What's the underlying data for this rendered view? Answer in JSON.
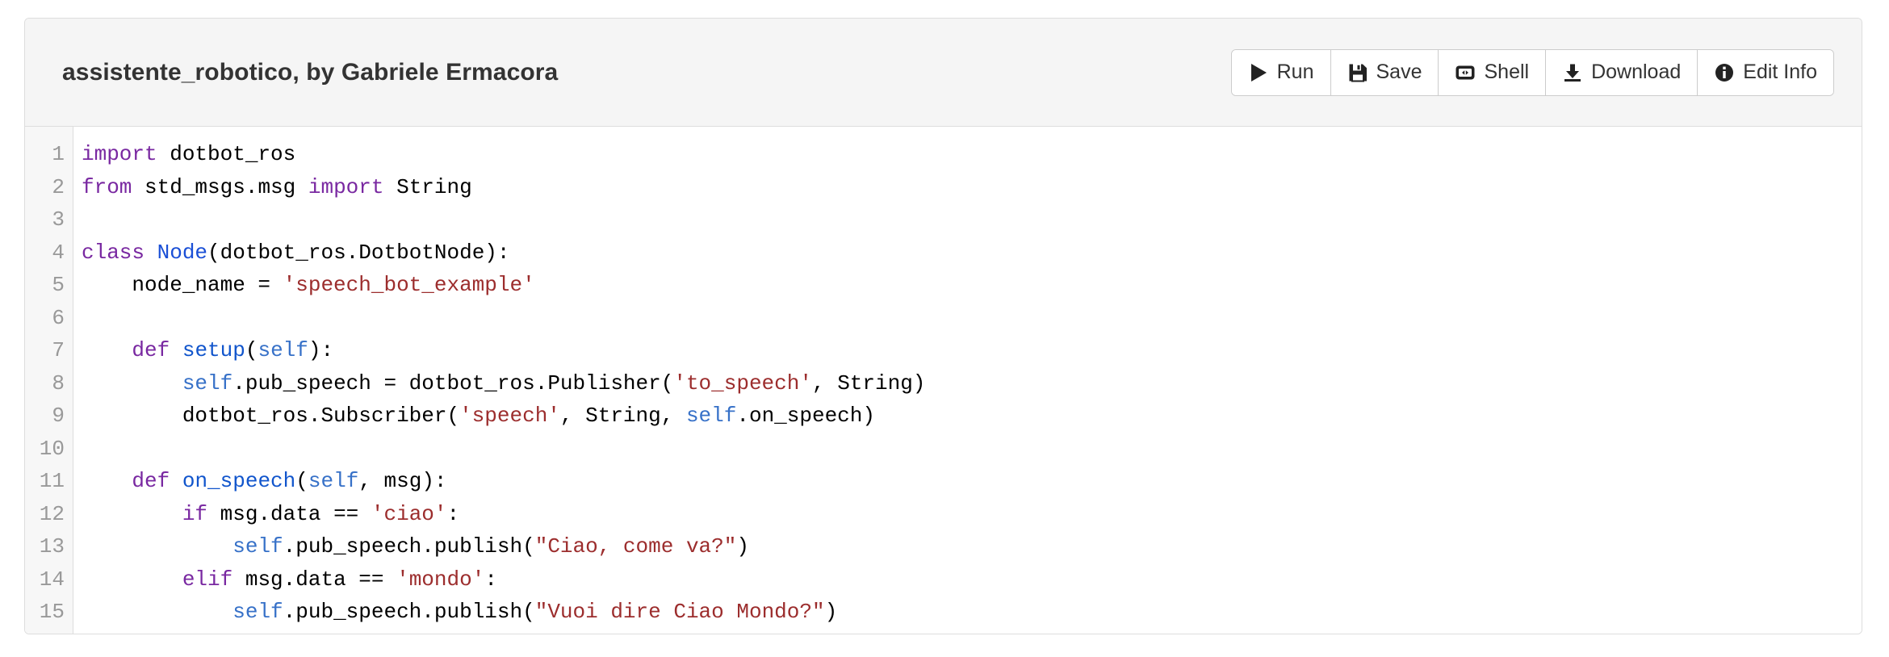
{
  "header": {
    "title": "assistente_robotico, by Gabriele Ermacora",
    "toolbar": [
      {
        "label": "Run",
        "icon": "play-icon"
      },
      {
        "label": "Save",
        "icon": "floppy-disk-icon"
      },
      {
        "label": "Shell",
        "icon": "shell-icon"
      },
      {
        "label": "Download",
        "icon": "download-icon"
      },
      {
        "label": "Edit Info",
        "icon": "info-circle-icon"
      }
    ]
  },
  "editor": {
    "language": "python",
    "first_visible_line": 1,
    "last_visible_line": 15,
    "line_numbers": [
      "1",
      "2",
      "3",
      "4",
      "5",
      "6",
      "7",
      "8",
      "9",
      "10",
      "11",
      "12",
      "13",
      "14",
      "15"
    ],
    "lines": [
      {
        "n": "1",
        "tokens": [
          {
            "t": "import",
            "c": "kw"
          },
          {
            "t": " dotbot_ros",
            "c": "pl"
          }
        ]
      },
      {
        "n": "2",
        "tokens": [
          {
            "t": "from",
            "c": "kw"
          },
          {
            "t": " std_msgs.msg ",
            "c": "pl"
          },
          {
            "t": "import",
            "c": "kw"
          },
          {
            "t": " String",
            "c": "pl"
          }
        ]
      },
      {
        "n": "3",
        "tokens": [
          {
            "t": "",
            "c": "pl"
          }
        ]
      },
      {
        "n": "4",
        "tokens": [
          {
            "t": "class",
            "c": "kw"
          },
          {
            "t": " ",
            "c": "pl"
          },
          {
            "t": "Node",
            "c": "cls"
          },
          {
            "t": "(dotbot_ros.DotbotNode):",
            "c": "pl"
          }
        ]
      },
      {
        "n": "5",
        "tokens": [
          {
            "t": "    node_name = ",
            "c": "pl"
          },
          {
            "t": "'speech_bot_example'",
            "c": "str"
          }
        ]
      },
      {
        "n": "6",
        "tokens": [
          {
            "t": "",
            "c": "pl"
          }
        ]
      },
      {
        "n": "7",
        "tokens": [
          {
            "t": "    ",
            "c": "pl"
          },
          {
            "t": "def",
            "c": "kw"
          },
          {
            "t": " ",
            "c": "pl"
          },
          {
            "t": "setup",
            "c": "fn"
          },
          {
            "t": "(",
            "c": "pl"
          },
          {
            "t": "self",
            "c": "self"
          },
          {
            "t": "):",
            "c": "pl"
          }
        ]
      },
      {
        "n": "8",
        "tokens": [
          {
            "t": "        ",
            "c": "pl"
          },
          {
            "t": "self",
            "c": "self"
          },
          {
            "t": ".pub_speech = dotbot_ros.Publisher(",
            "c": "pl"
          },
          {
            "t": "'to_speech'",
            "c": "str"
          },
          {
            "t": ", String)",
            "c": "pl"
          }
        ]
      },
      {
        "n": "9",
        "tokens": [
          {
            "t": "        dotbot_ros.Subscriber(",
            "c": "pl"
          },
          {
            "t": "'speech'",
            "c": "str"
          },
          {
            "t": ", String, ",
            "c": "pl"
          },
          {
            "t": "self",
            "c": "self"
          },
          {
            "t": ".on_speech)",
            "c": "pl"
          }
        ]
      },
      {
        "n": "10",
        "tokens": [
          {
            "t": "",
            "c": "pl"
          }
        ]
      },
      {
        "n": "11",
        "tokens": [
          {
            "t": "    ",
            "c": "pl"
          },
          {
            "t": "def",
            "c": "kw"
          },
          {
            "t": " ",
            "c": "pl"
          },
          {
            "t": "on_speech",
            "c": "fn"
          },
          {
            "t": "(",
            "c": "pl"
          },
          {
            "t": "self",
            "c": "self"
          },
          {
            "t": ", msg):",
            "c": "pl"
          }
        ]
      },
      {
        "n": "12",
        "tokens": [
          {
            "t": "        ",
            "c": "pl"
          },
          {
            "t": "if",
            "c": "kw"
          },
          {
            "t": " msg.data == ",
            "c": "pl"
          },
          {
            "t": "'ciao'",
            "c": "str"
          },
          {
            "t": ":",
            "c": "pl"
          }
        ]
      },
      {
        "n": "13",
        "tokens": [
          {
            "t": "            ",
            "c": "pl"
          },
          {
            "t": "self",
            "c": "self"
          },
          {
            "t": ".pub_speech.publish(",
            "c": "pl"
          },
          {
            "t": "\"Ciao, come va?\"",
            "c": "str"
          },
          {
            "t": ")",
            "c": "pl"
          }
        ]
      },
      {
        "n": "14",
        "tokens": [
          {
            "t": "        ",
            "c": "pl"
          },
          {
            "t": "elif",
            "c": "kw"
          },
          {
            "t": " msg.data == ",
            "c": "pl"
          },
          {
            "t": "'mondo'",
            "c": "str"
          },
          {
            "t": ":",
            "c": "pl"
          }
        ]
      },
      {
        "n": "15",
        "tokens": [
          {
            "t": "            ",
            "c": "pl"
          },
          {
            "t": "self",
            "c": "self"
          },
          {
            "t": ".pub_speech.publish(",
            "c": "pl"
          },
          {
            "t": "\"Vuoi dire Ciao Mondo?\"",
            "c": "str"
          },
          {
            "t": ")",
            "c": "pl"
          }
        ]
      }
    ]
  },
  "colors": {
    "panel_border": "#dddddd",
    "header_bg": "#f5f5f5",
    "gutter_bg": "#f7f7f7",
    "line_number": "#999999",
    "keyword": "#7928a1",
    "function": "#1155cc",
    "self": "#3771c8",
    "string": "#9c2d2d",
    "text": "#333333"
  }
}
